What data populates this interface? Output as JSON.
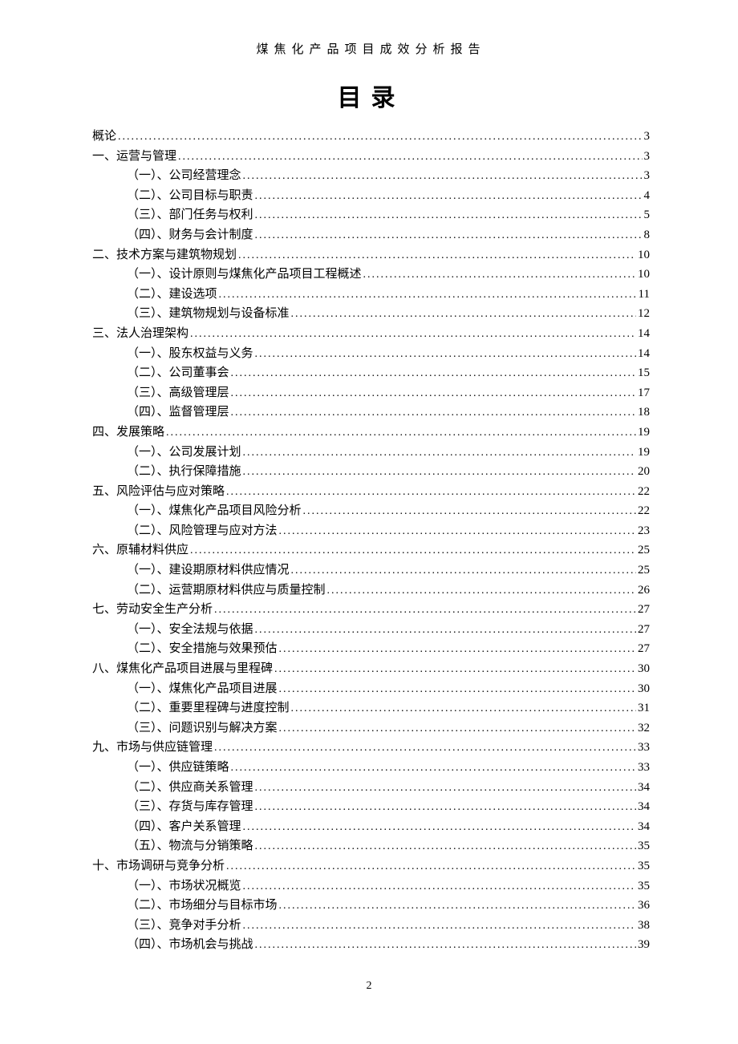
{
  "header": "煤焦化产品项目成效分析报告",
  "title": "目录",
  "page_number": "2",
  "toc": [
    {
      "level": 0,
      "label": "概论",
      "page": "3"
    },
    {
      "level": 1,
      "label": "一、运营与管理",
      "page": "3"
    },
    {
      "level": 2,
      "label": "（一）、公司经营理念",
      "page": "3"
    },
    {
      "level": 2,
      "label": "（二）、公司目标与职责",
      "page": "4"
    },
    {
      "level": 2,
      "label": "（三）、部门任务与权利",
      "page": "5"
    },
    {
      "level": 2,
      "label": "（四）、财务与会计制度",
      "page": "8"
    },
    {
      "level": 1,
      "label": "二、技术方案与建筑物规划",
      "page": "10"
    },
    {
      "level": 2,
      "label": "（一）、设计原则与煤焦化产品项目工程概述",
      "page": "10"
    },
    {
      "level": 2,
      "label": "（二）、建设选项",
      "page": "11"
    },
    {
      "level": 2,
      "label": "（三）、建筑物规划与设备标准",
      "page": "12"
    },
    {
      "level": 1,
      "label": "三、法人治理架构",
      "page": "14"
    },
    {
      "level": 2,
      "label": "（一）、股东权益与义务",
      "page": "14"
    },
    {
      "level": 2,
      "label": "（二）、公司董事会",
      "page": "15"
    },
    {
      "level": 2,
      "label": "（三）、高级管理层",
      "page": "17"
    },
    {
      "level": 2,
      "label": "（四）、监督管理层",
      "page": "18"
    },
    {
      "level": 1,
      "label": "四、发展策略",
      "page": "19"
    },
    {
      "level": 2,
      "label": "（一）、公司发展计划",
      "page": "19"
    },
    {
      "level": 2,
      "label": "（二）、执行保障措施",
      "page": "20"
    },
    {
      "level": 1,
      "label": "五、风险评估与应对策略",
      "page": "22"
    },
    {
      "level": 2,
      "label": "（一）、煤焦化产品项目风险分析",
      "page": "22"
    },
    {
      "level": 2,
      "label": "（二）、风险管理与应对方法",
      "page": "23"
    },
    {
      "level": 1,
      "label": "六、原辅材料供应",
      "page": "25"
    },
    {
      "level": 2,
      "label": "（一）、建设期原材料供应情况",
      "page": "25"
    },
    {
      "level": 2,
      "label": "（二）、运营期原材料供应与质量控制",
      "page": "26"
    },
    {
      "level": 1,
      "label": "七、劳动安全生产分析",
      "page": "27"
    },
    {
      "level": 2,
      "label": "（一）、安全法规与依据",
      "page": "27"
    },
    {
      "level": 2,
      "label": "（二）、安全措施与效果预估",
      "page": "27"
    },
    {
      "level": 1,
      "label": "八、煤焦化产品项目进展与里程碑",
      "page": "30"
    },
    {
      "level": 2,
      "label": "（一）、煤焦化产品项目进展",
      "page": "30"
    },
    {
      "level": 2,
      "label": "（二）、重要里程碑与进度控制",
      "page": "31"
    },
    {
      "level": 2,
      "label": "（三）、问题识别与解决方案",
      "page": "32"
    },
    {
      "level": 1,
      "label": "九、市场与供应链管理",
      "page": "33"
    },
    {
      "level": 2,
      "label": "（一）、供应链策略",
      "page": "33"
    },
    {
      "level": 2,
      "label": "（二）、供应商关系管理",
      "page": "34"
    },
    {
      "level": 2,
      "label": "（三）、存货与库存管理",
      "page": "34"
    },
    {
      "level": 2,
      "label": "（四）、客户关系管理",
      "page": "34"
    },
    {
      "level": 2,
      "label": "（五）、物流与分销策略",
      "page": "35"
    },
    {
      "level": 1,
      "label": "十、市场调研与竞争分析",
      "page": "35"
    },
    {
      "level": 2,
      "label": "（一）、市场状况概览",
      "page": "35"
    },
    {
      "level": 2,
      "label": "（二）、市场细分与目标市场",
      "page": "36"
    },
    {
      "level": 2,
      "label": "（三）、竞争对手分析",
      "page": "38"
    },
    {
      "level": 2,
      "label": "（四）、市场机会与挑战",
      "page": "39"
    }
  ]
}
